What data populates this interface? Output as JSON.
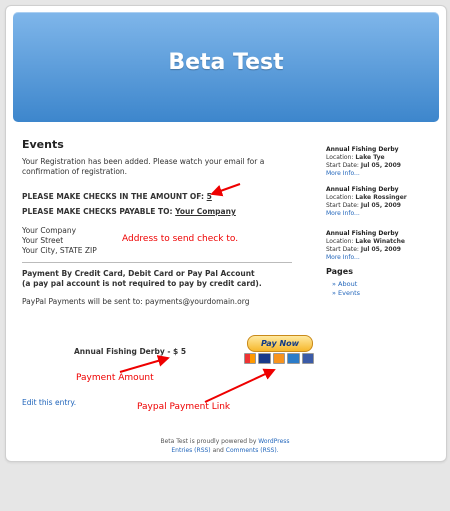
{
  "site": {
    "title": "Beta Test"
  },
  "content": {
    "heading": "Events",
    "registration_msg": "Your Registration has been added. Please watch your email for a confirmation of registration.",
    "amount_label": "PLEASE MAKE CHECKS IN THE AMOUNT OF:",
    "amount_value": "5",
    "payable_label": "PLEASE MAKE CHECKS PAYABLE TO:",
    "payable_value": "Your Company",
    "address": [
      "Your Company",
      "Your Street",
      "Your City, STATE ZIP"
    ],
    "cc_title_line1": "Payment By Credit Card, Debit Card or Pay Pal Account",
    "cc_title_line2": "(a pay pal account is not required to pay by credit card).",
    "paypal_sent": "PayPal Payments will be sent to: payments@yourdomain.org",
    "event_amount": "Annual Fishing Derby - $ 5",
    "edit_link": "Edit this entry.",
    "paynow_label": "Pay Now"
  },
  "annotations": {
    "address_note": "Address to send check to.",
    "payment_amount": "Payment Amount",
    "paypal_link": "Paypal Payment Link"
  },
  "sidebar": {
    "events": [
      {
        "title": "Annual Fishing Derby",
        "location_label": "Location:",
        "location": "Lake Tye",
        "start_label": "Start Date:",
        "start": "Jul 05, 2009",
        "more": "More Info..."
      },
      {
        "title": "Annual Fishing Derby",
        "location_label": "Location:",
        "location": "Lake Rossinger",
        "start_label": "Start Date:",
        "start": "Jul 05, 2009",
        "more": "More Info..."
      },
      {
        "title": "Annual Fishing Derby",
        "location_label": "Location:",
        "location": "Lake Winatche",
        "start_label": "Start Date:",
        "start": "Jul 05, 2009",
        "more": "More Info..."
      }
    ],
    "pages_heading": "Pages",
    "pages": [
      "» About",
      "» Events"
    ]
  },
  "footer": {
    "pre": "Beta Test is proudly powered by",
    "wp": "WordPress",
    "entries": "Entries (RSS)",
    "and": "and",
    "comments": "Comments (RSS)."
  },
  "colors": {
    "header_top": "#7fb6ea",
    "header_bottom": "#3d86cc",
    "annotation": "#ee0000",
    "link": "#2266bb"
  }
}
